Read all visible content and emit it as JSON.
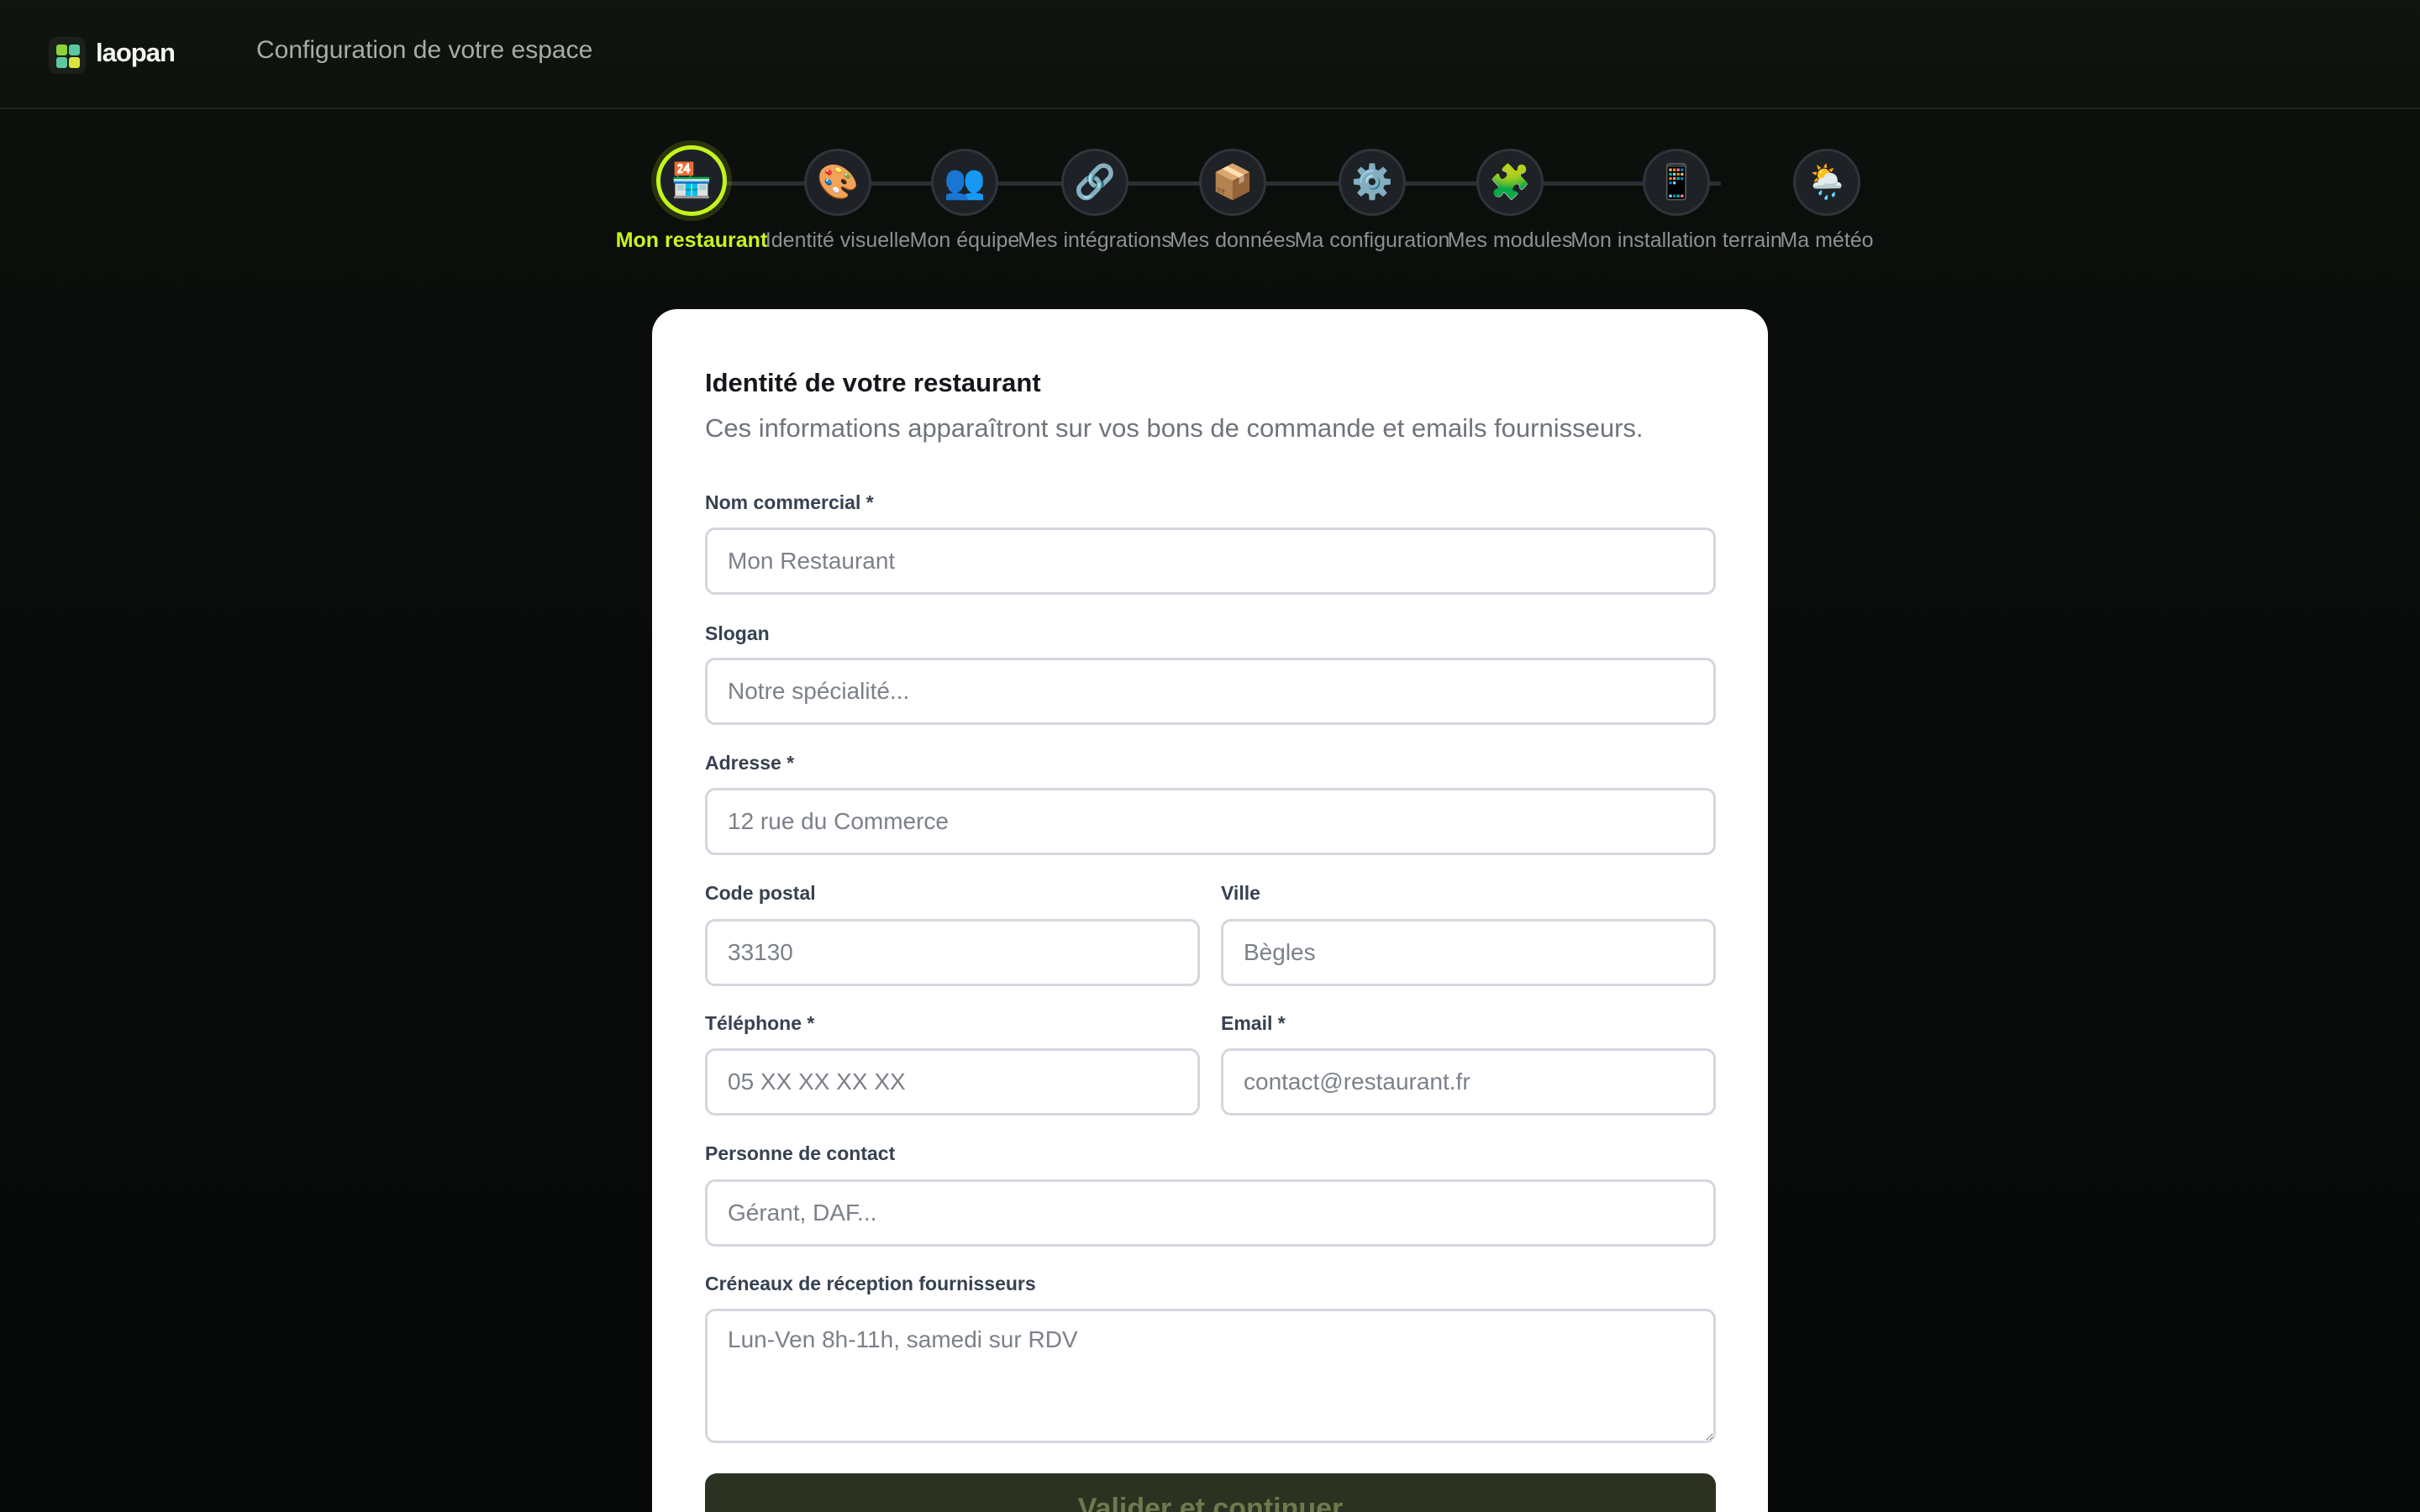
{
  "header": {
    "brand": "laopan",
    "title": "Configuration de votre espace"
  },
  "steps": [
    {
      "icon": "🏪",
      "icon_name": "store-icon",
      "label": "Mon restaurant",
      "active": true
    },
    {
      "icon": "🎨",
      "icon_name": "palette-icon",
      "label": "Identité visuelle",
      "active": false
    },
    {
      "icon": "👥",
      "icon_name": "team-icon",
      "label": "Mon équipe",
      "active": false
    },
    {
      "icon": "🔗",
      "icon_name": "link-icon",
      "label": "Mes intégrations",
      "active": false
    },
    {
      "icon": "📦",
      "icon_name": "package-icon",
      "label": "Mes données",
      "active": false
    },
    {
      "icon": "⚙️",
      "icon_name": "gear-icon",
      "label": "Ma configuration",
      "active": false
    },
    {
      "icon": "🧩",
      "icon_name": "puzzle-icon",
      "label": "Mes modules",
      "active": false
    },
    {
      "icon": "📱",
      "icon_name": "phone-icon",
      "label": "Mon installation terrain",
      "active": false
    },
    {
      "icon": "🌦️",
      "icon_name": "weather-icon",
      "label": "Ma météo",
      "active": false
    }
  ],
  "form": {
    "title": "Identité de votre restaurant",
    "subtitle": "Ces informations apparaîtront sur vos bons de commande et emails fournisseurs.",
    "nom_commercial": {
      "label": "Nom commercial *",
      "placeholder": "Mon Restaurant",
      "value": ""
    },
    "slogan": {
      "label": "Slogan",
      "placeholder": "Notre spécialité...",
      "value": ""
    },
    "adresse": {
      "label": "Adresse *",
      "placeholder": "12 rue du Commerce",
      "value": ""
    },
    "code_postal": {
      "label": "Code postal",
      "placeholder": "33130",
      "value": ""
    },
    "ville": {
      "label": "Ville",
      "placeholder": "Bègles",
      "value": ""
    },
    "telephone": {
      "label": "Téléphone *",
      "placeholder": "05 XX XX XX XX",
      "value": ""
    },
    "email": {
      "label": "Email *",
      "placeholder": "contact@restaurant.fr",
      "value": ""
    },
    "contact": {
      "label": "Personne de contact",
      "placeholder": "Gérant, DAF...",
      "value": ""
    },
    "creneaux": {
      "label": "Créneaux de réception fournisseurs",
      "placeholder": "Lun-Ven 8h-11h, samedi sur RDV",
      "value": ""
    },
    "submit_label": "Valider et continuer"
  },
  "colors": {
    "accent": "#c4f51b",
    "background": "#0a0c0b",
    "card": "#ffffff",
    "submit_bg": "#2b3221"
  }
}
